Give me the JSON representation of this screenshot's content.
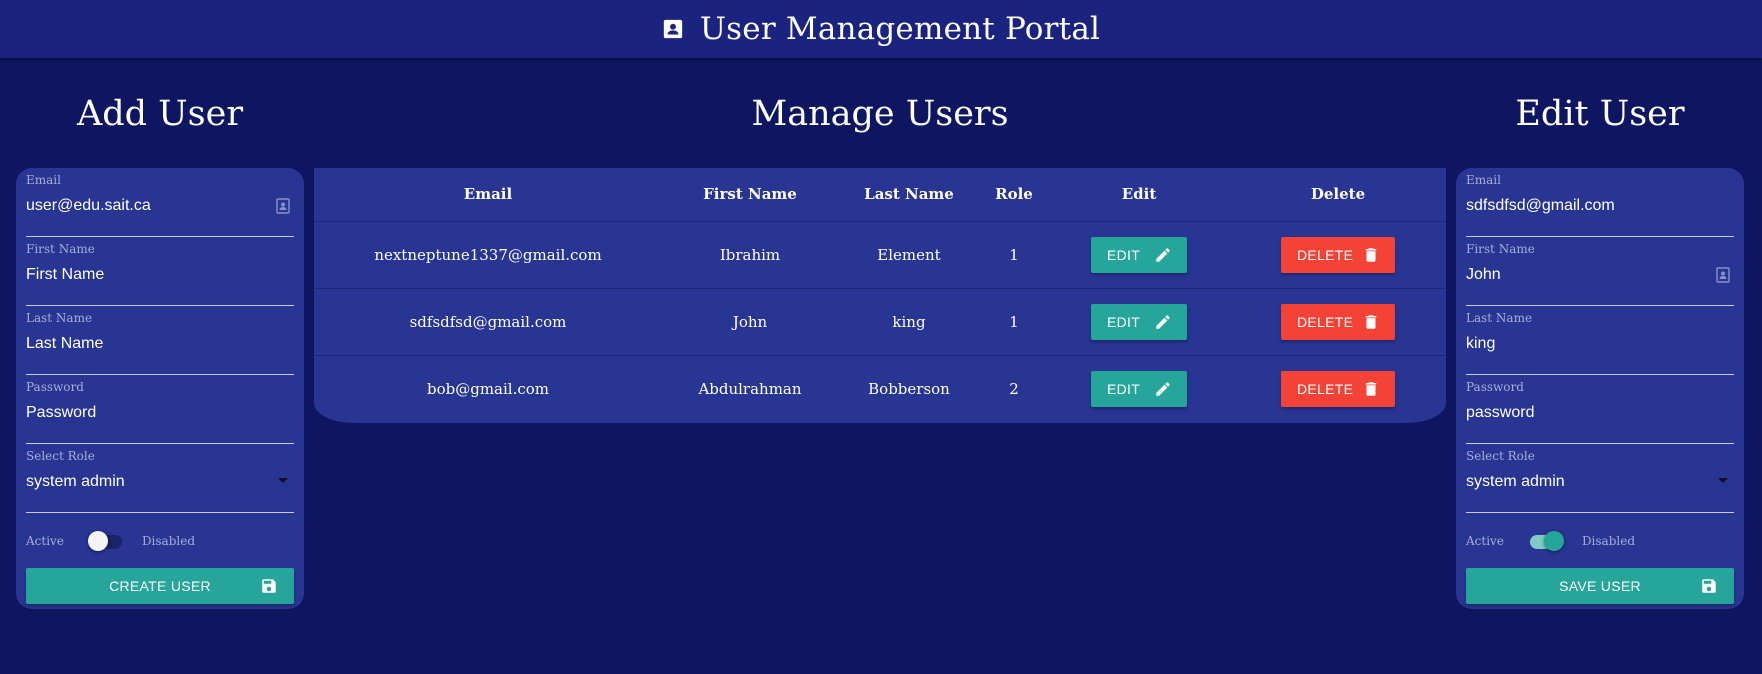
{
  "header": {
    "title": "User Management Portal",
    "icon": "contact-card-icon"
  },
  "add_user": {
    "title": "Add User",
    "email_label": "Email",
    "email_value": "user@edu.sait.ca",
    "first_name_label": "First Name",
    "first_name_placeholder": "First Name",
    "last_name_label": "Last Name",
    "last_name_placeholder": "Last Name",
    "password_label": "Password",
    "password_placeholder": "Password",
    "role_label": "Select Role",
    "role_value": "system admin",
    "active_label": "Active",
    "disabled_label": "Disabled",
    "toggle_state": "off",
    "button_label": "CREATE USER"
  },
  "manage_users": {
    "title": "Manage Users",
    "columns": [
      "Email",
      "First Name",
      "Last Name",
      "Role",
      "Edit",
      "Delete"
    ],
    "edit_label": "EDIT",
    "delete_label": "DELETE",
    "rows": [
      {
        "email": "nextneptune1337@gmail.com",
        "first": "Ibrahim",
        "last": "Element",
        "role": "1"
      },
      {
        "email": "sdfsdfsd@gmail.com",
        "first": "John",
        "last": "king",
        "role": "1"
      },
      {
        "email": "bob@gmail.com",
        "first": "Abdulrahman",
        "last": "Bobberson",
        "role": "2"
      }
    ]
  },
  "edit_user": {
    "title": "Edit User",
    "email_label": "Email",
    "email_value": "sdfsdfsd@gmail.com",
    "first_name_label": "First Name",
    "first_name_value": "John",
    "last_name_label": "Last Name",
    "last_name_value": "king",
    "password_label": "Password",
    "password_value": "password",
    "role_label": "Select Role",
    "role_value": "system admin",
    "active_label": "Active",
    "disabled_label": "Disabled",
    "toggle_state": "on",
    "button_label": "SAVE USER"
  },
  "colors": {
    "background": "#0e1661",
    "header": "#1a237e",
    "card": "#283593",
    "teal": "#26a69a",
    "red": "#f44336"
  }
}
